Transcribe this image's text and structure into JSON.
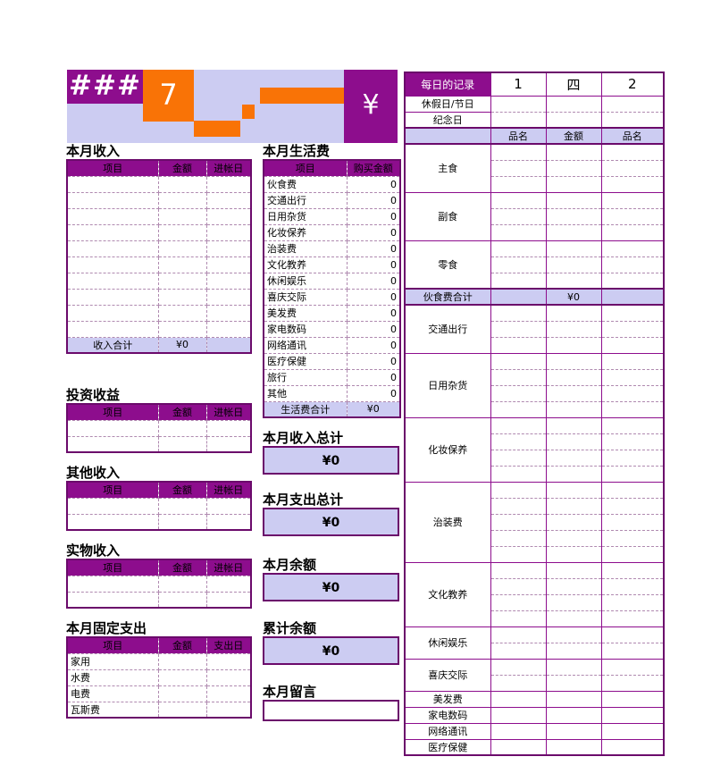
{
  "banner": {
    "hash_text": "###",
    "month_number": "7",
    "currency_symbol": "¥"
  },
  "colors": {
    "purple": "#8d0d8d",
    "dark_purple": "#6b0a6b",
    "lavender": "#ccccf2",
    "orange": "#f97306",
    "white": "#ffffff"
  },
  "income": {
    "title": "本月收入",
    "columns": [
      "项目",
      "金额",
      "进帐日"
    ],
    "row_count": 10,
    "total_label": "收入合计",
    "total_value": "¥0"
  },
  "investment": {
    "title": "投资收益",
    "columns": [
      "项目",
      "金额",
      "进帐日"
    ],
    "row_count": 2
  },
  "other_income": {
    "title": "其他收入",
    "columns": [
      "项目",
      "金额",
      "进帐日"
    ],
    "row_count": 2
  },
  "in_kind_income": {
    "title": "实物收入",
    "columns": [
      "项目",
      "金额",
      "进帐日"
    ],
    "row_count": 2
  },
  "fixed_expense": {
    "title": "本月固定支出",
    "columns": [
      "项目",
      "金额",
      "支出日"
    ],
    "rows": [
      {
        "item": "家用",
        "amount": "",
        "date": ""
      },
      {
        "item": "水费",
        "amount": "",
        "date": ""
      },
      {
        "item": "电费",
        "amount": "",
        "date": ""
      },
      {
        "item": "瓦斯费",
        "amount": "",
        "date": ""
      }
    ]
  },
  "living_expense": {
    "title": "本月生活费",
    "columns": [
      "项目",
      "购买金额"
    ],
    "rows": [
      {
        "item": "伙食费",
        "amount": "0"
      },
      {
        "item": "交通出行",
        "amount": "0"
      },
      {
        "item": "日用杂货",
        "amount": "0"
      },
      {
        "item": "化妆保养",
        "amount": "0"
      },
      {
        "item": "治装费",
        "amount": "0"
      },
      {
        "item": "文化教养",
        "amount": "0"
      },
      {
        "item": "休闲娱乐",
        "amount": "0"
      },
      {
        "item": "喜庆交际",
        "amount": "0"
      },
      {
        "item": "美发费",
        "amount": "0"
      },
      {
        "item": "家电数码",
        "amount": "0"
      },
      {
        "item": "网络通讯",
        "amount": "0"
      },
      {
        "item": "医疗保健",
        "amount": "0"
      },
      {
        "item": "旅行",
        "amount": "0"
      },
      {
        "item": "其他",
        "amount": "0"
      }
    ],
    "total_label": "生活费合计",
    "total_value": "¥0"
  },
  "summaries": [
    {
      "label": "本月收入总计",
      "value": "¥0"
    },
    {
      "label": "本月支出总计",
      "value": "¥0"
    },
    {
      "label": "本月余额",
      "value": "¥0"
    },
    {
      "label": "累计余额",
      "value": "¥0"
    }
  ],
  "message": {
    "label": "本月留言",
    "value": ""
  },
  "daily": {
    "title": "每日的记录",
    "day_headers": [
      "1",
      "四",
      "2"
    ],
    "holiday_label": "休假日/节日",
    "anniversary_label": "纪念日",
    "sub_headers": [
      "品名",
      "金额",
      "品名"
    ],
    "groups": [
      {
        "name": "主食",
        "rows": 3
      },
      {
        "name": "副食",
        "rows": 3
      },
      {
        "name": "零食",
        "rows": 3
      }
    ],
    "food_total_label": "伙食费合计",
    "food_total_value": "¥0",
    "categories": [
      {
        "name": "交通出行",
        "rows": 3
      },
      {
        "name": "日用杂货",
        "rows": 4
      },
      {
        "name": "化妆保养",
        "rows": 4
      },
      {
        "name": "治装费",
        "rows": 5
      },
      {
        "name": "文化教养",
        "rows": 4
      },
      {
        "name": "休闲娱乐",
        "rows": 2
      },
      {
        "name": "喜庆交际",
        "rows": 2
      },
      {
        "name": "美发费",
        "rows": 1
      },
      {
        "name": "家电数码",
        "rows": 1
      },
      {
        "name": "网络通讯",
        "rows": 1
      },
      {
        "name": "医疗保健",
        "rows": 1
      }
    ]
  }
}
